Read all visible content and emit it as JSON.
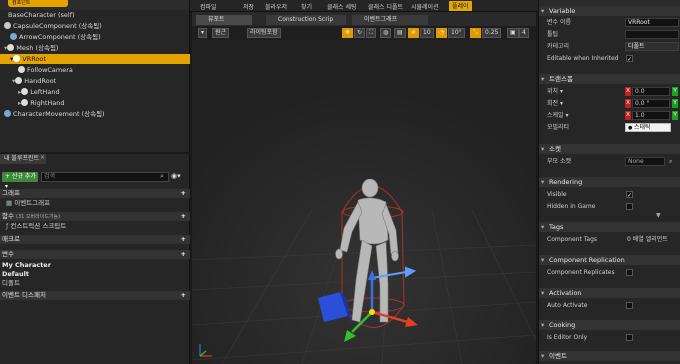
{
  "toolbar": {
    "items": [
      "컴파일",
      "저장",
      "블라우저",
      "찾기",
      "클래스 세팅",
      "클래스 디폴트",
      "시뮬레이션",
      "플레이"
    ]
  },
  "components": {
    "tab_label": "컴포넌트",
    "root": "BaseCharacter (self)",
    "items": [
      {
        "label": "CapsuleComponent (상속됨)"
      },
      {
        "label": "ArrowComponent (상속됨)"
      },
      {
        "label": "Mesh (상속됨)"
      },
      {
        "label": "VRRoot"
      },
      {
        "label": "FollowCamera"
      },
      {
        "label": "HandRoot"
      },
      {
        "label": "LeftHand"
      },
      {
        "label": "RightHand"
      },
      {
        "label": "CharacterMovement (상속됨)"
      }
    ]
  },
  "my_blueprint": {
    "tab_label": "내 블루프린트",
    "add_label": "+ 신규 추가 ▾",
    "search_placeholder": "검색",
    "graphs_label": "그래프",
    "event_graph_label": "이벤트그래프",
    "functions_label": "함수",
    "functions_override": "(31 오버라이드가능)",
    "construction_label": "컨스트럭션 스크립트",
    "macros_label": "매크로",
    "variables_label": "변수",
    "var_items": [
      "My Character",
      "Default",
      "디폴트"
    ],
    "dispatchers_label": "이벤트 디스패처"
  },
  "viewport": {
    "tabs": [
      "뷰포트",
      "Construction Scrip",
      "이벤트그래프"
    ],
    "perspective_label": "원근",
    "lit_label": "라이팅포함",
    "grid_value": "10",
    "rot_value": "10°",
    "scale_value": "0.25",
    "cam_value": "4"
  },
  "details": {
    "variable_header": "Variable",
    "var_name_label": "변수 이름",
    "var_name_value": "VRRoot",
    "tooltip_label": "툴팁",
    "category_label": "카테고리",
    "category_value": "디폴트",
    "editable_label": "Editable when Inherited",
    "transform_header": "트랜스폼",
    "location_label": "위치 ▾",
    "rotation_label": "회전 ▾",
    "scale_label": "스케일 ▾",
    "mobility_label": "모빌리티",
    "mobility_value": "스태틱",
    "location_x": "0.0",
    "rotation_x": "0.0 °",
    "scale_x": "1.0",
    "socket_header": "소켓",
    "parent_socket_label": "부모 소켓",
    "parent_socket_value": "None",
    "rendering_header": "Rendering",
    "visible_label": "Visible",
    "hidden_label": "Hidden in Game",
    "tags_header": "Tags",
    "component_tags_label": "Component Tags",
    "component_tags_value": "0 배열 엘리먼트",
    "replication_header": "Component Replication",
    "replicates_label": "Component Replicates",
    "activation_header": "Activation",
    "auto_activate_label": "Auto Activate",
    "cooking_header": "Cooking",
    "editor_only_label": "Is Editor Only",
    "events_header": "이벤트"
  }
}
